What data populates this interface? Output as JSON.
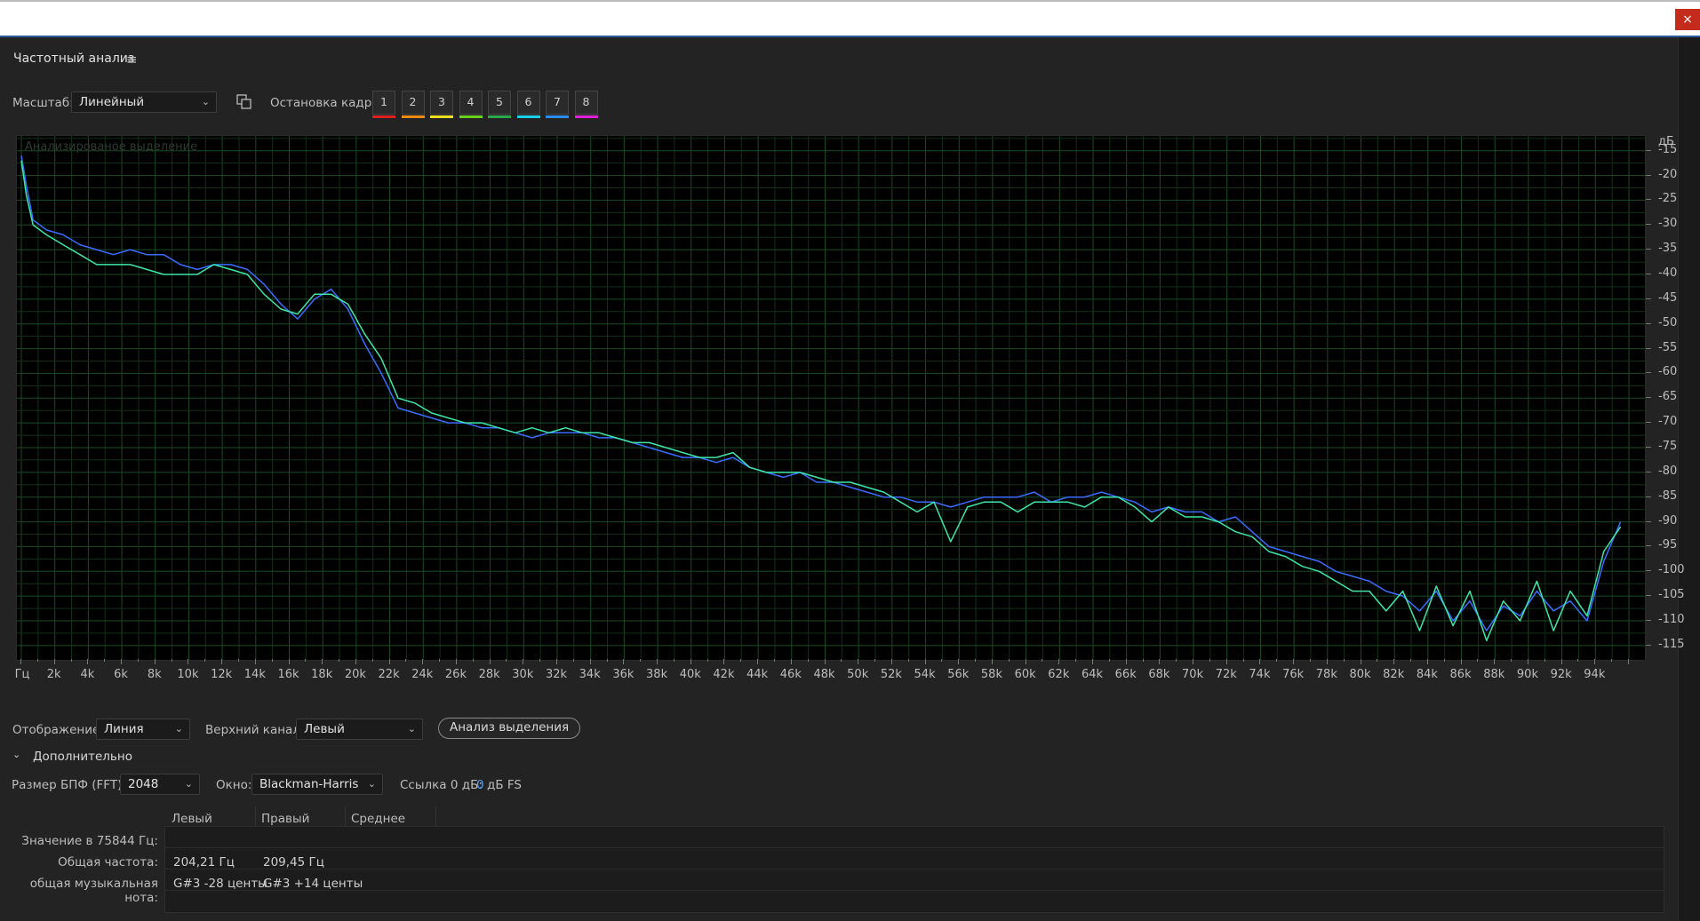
{
  "window": {
    "close_glyph": "×"
  },
  "panel": {
    "title": "Частотный анализ",
    "menu_icon": "≡"
  },
  "toolbar": {
    "scale_label": "Масштаб:",
    "scale_value": "Линейный",
    "copy_icon": "copy-icon",
    "freeze_label": "Остановка кадра:",
    "freeze_frames": [
      {
        "label": "1",
        "color": "#e02020"
      },
      {
        "label": "2",
        "color": "#f08a10"
      },
      {
        "label": "3",
        "color": "#f0e020"
      },
      {
        "label": "4",
        "color": "#6ad21a"
      },
      {
        "label": "5",
        "color": "#2aa84a"
      },
      {
        "label": "6",
        "color": "#18d0e8"
      },
      {
        "label": "7",
        "color": "#2a8cf0"
      },
      {
        "label": "8",
        "color": "#e020d8"
      }
    ]
  },
  "spectrum": {
    "overlay_label": "Анализированое выделение",
    "db_unit": "дБ",
    "hz_unit": "Гц"
  },
  "chart_data": {
    "type": "line",
    "xlabel": "Гц",
    "ylabel": "дБ",
    "xlim": [
      0,
      96000
    ],
    "ylim": [
      -117,
      -12
    ],
    "x_ticks": [
      "2k",
      "4k",
      "6k",
      "8k",
      "10k",
      "12k",
      "14k",
      "16k",
      "18k",
      "20k",
      "22k",
      "24k",
      "26k",
      "28k",
      "30k",
      "32k",
      "34k",
      "36k",
      "38k",
      "40k",
      "42k",
      "44k",
      "46k",
      "48k",
      "50k",
      "52k",
      "54k",
      "56k",
      "58k",
      "60k",
      "62k",
      "64k",
      "66k",
      "68k",
      "70k",
      "72k",
      "74k",
      "76k",
      "78k",
      "80k",
      "82k",
      "84k",
      "86k",
      "88k",
      "90k",
      "92k",
      "94k"
    ],
    "y_ticks": [
      -15,
      -20,
      -25,
      -30,
      -35,
      -40,
      -45,
      -50,
      -55,
      -60,
      -65,
      -70,
      -75,
      -80,
      -85,
      -90,
      -95,
      -100,
      -105,
      -110,
      -115
    ],
    "grid": true,
    "series": [
      {
        "color": "#3a6cff",
        "x": [
          0,
          300,
          700,
          1500,
          2500,
          3500,
          4500,
          5500,
          6500,
          7500,
          8500,
          9500,
          10500,
          11500,
          12500,
          13500,
          14500,
          15500,
          16500,
          17500,
          18500,
          19500,
          20500,
          21500,
          22500,
          23500,
          24500,
          25500,
          26500,
          27500,
          28500,
          29500,
          30500,
          31500,
          32500,
          33500,
          34500,
          35500,
          36500,
          37500,
          38500,
          39500,
          40500,
          41500,
          42500,
          43500,
          44500,
          45500,
          46500,
          47500,
          48500,
          49500,
          50500,
          51500,
          52500,
          53500,
          54500,
          55500,
          56500,
          57500,
          58500,
          59500,
          60500,
          61500,
          62500,
          63500,
          64500,
          65500,
          66500,
          67500,
          68500,
          69500,
          70500,
          71500,
          72500,
          73500,
          74500,
          75500,
          76500,
          77500,
          78500,
          79500,
          80500,
          81500,
          82500,
          83500,
          84500,
          85500,
          86500,
          87500,
          88500,
          89500,
          90500,
          91500,
          92500,
          93500,
          94500,
          95500
        ],
        "values": [
          -16,
          -22,
          -29,
          -31,
          -32,
          -34,
          -35,
          -36,
          -35,
          -36,
          -36,
          -38,
          -39,
          -38,
          -38,
          -39,
          -42,
          -46,
          -49,
          -45,
          -43,
          -47,
          -54,
          -60,
          -67,
          -68,
          -69,
          -70,
          -70,
          -71,
          -71,
          -72,
          -73,
          -72,
          -72,
          -72,
          -73,
          -73,
          -74,
          -75,
          -76,
          -77,
          -77,
          -78,
          -77,
          -79,
          -80,
          -81,
          -80,
          -82,
          -82,
          -83,
          -84,
          -85,
          -85,
          -86,
          -86,
          -87,
          -86,
          -85,
          -85,
          -85,
          -84,
          -86,
          -85,
          -85,
          -84,
          -85,
          -86,
          -88,
          -87,
          -88,
          -88,
          -90,
          -89,
          -92,
          -95,
          -96,
          -97,
          -98,
          -100,
          -101,
          -102,
          -104,
          -105,
          -108,
          -104,
          -110,
          -106,
          -112,
          -107,
          -109,
          -104,
          -108,
          -106,
          -110,
          -98,
          -90
        ]
      },
      {
        "color": "#3fe6a8",
        "x": [
          0,
          300,
          700,
          1500,
          2500,
          3500,
          4500,
          5500,
          6500,
          7500,
          8500,
          9500,
          10500,
          11500,
          12500,
          13500,
          14500,
          15500,
          16500,
          17500,
          18500,
          19500,
          20500,
          21500,
          22500,
          23500,
          24500,
          25500,
          26500,
          27500,
          28500,
          29500,
          30500,
          31500,
          32500,
          33500,
          34500,
          35500,
          36500,
          37500,
          38500,
          39500,
          40500,
          41500,
          42500,
          43500,
          44500,
          45500,
          46500,
          47500,
          48500,
          49500,
          50500,
          51500,
          52500,
          53500,
          54500,
          55500,
          56500,
          57500,
          58500,
          59500,
          60500,
          61500,
          62500,
          63500,
          64500,
          65500,
          66500,
          67500,
          68500,
          69500,
          70500,
          71500,
          72500,
          73500,
          74500,
          75500,
          76500,
          77500,
          78500,
          79500,
          80500,
          81500,
          82500,
          83500,
          84500,
          85500,
          86500,
          87500,
          88500,
          89500,
          90500,
          91500,
          92500,
          93500,
          94500,
          95500
        ],
        "values": [
          -17,
          -24,
          -30,
          -32,
          -34,
          -36,
          -38,
          -38,
          -38,
          -39,
          -40,
          -40,
          -40,
          -38,
          -39,
          -40,
          -44,
          -47,
          -48,
          -44,
          -44,
          -46,
          -52,
          -57,
          -65,
          -66,
          -68,
          -69,
          -70,
          -70,
          -71,
          -72,
          -71,
          -72,
          -71,
          -72,
          -72,
          -73,
          -74,
          -74,
          -75,
          -76,
          -77,
          -77,
          -76,
          -79,
          -80,
          -80,
          -80,
          -81,
          -82,
          -82,
          -83,
          -84,
          -86,
          -88,
          -86,
          -94,
          -87,
          -86,
          -86,
          -88,
          -86,
          -86,
          -86,
          -87,
          -85,
          -85,
          -87,
          -90,
          -87,
          -89,
          -89,
          -90,
          -92,
          -93,
          -96,
          -97,
          -99,
          -100,
          -102,
          -104,
          -104,
          -108,
          -104,
          -112,
          -103,
          -111,
          -104,
          -114,
          -106,
          -110,
          -102,
          -112,
          -104,
          -109,
          -96,
          -91
        ]
      }
    ]
  },
  "bottom": {
    "display_label": "Отображение:",
    "display_value": "Линия",
    "top_channel_label": "Верхний канал:",
    "top_channel_value": "Левый",
    "analyze_button": "Анализ выделения",
    "advanced_label": "Дополнительно",
    "fft_label": "Размер БПФ (FFT):",
    "fft_value": "2048",
    "window_label": "Окно:",
    "window_value": "Blackman-Harris",
    "ref_label": "Ссылка 0 дБ:",
    "ref_value": "0",
    "ref_unit": "дБ FS"
  },
  "table": {
    "columns": [
      "Левый",
      "Правый",
      "Среднее"
    ],
    "rows": [
      {
        "label": "Значение в 75844 Гц:",
        "left": "",
        "right": ""
      },
      {
        "label": "Общая частота:",
        "left": "204,21 Гц",
        "right": "209,45 Гц"
      },
      {
        "label": "общая музыкальная нота:",
        "left": "G#3 -28 центы",
        "right": "G#3 +14 центы"
      }
    ]
  }
}
